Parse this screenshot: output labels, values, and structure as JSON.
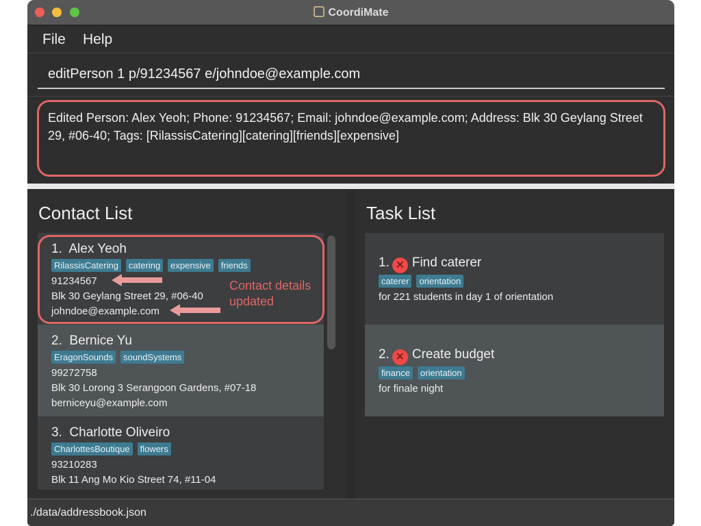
{
  "window": {
    "title": "CoordiMate"
  },
  "menu": [
    "File",
    "Help"
  ],
  "command": {
    "value": "editPerson 1 p/91234567 e/johndoe@example.com"
  },
  "result": {
    "text": "Edited Person: Alex Yeoh; Phone: 91234567; Email: johndoe@example.com; Address: Blk 30 Geylang Street 29, #06-40; Tags: [RilassisCatering][catering][friends][expensive]"
  },
  "contacts": {
    "title": "Contact List",
    "items": [
      {
        "index": "1.",
        "name": "Alex Yeoh",
        "tags": [
          "RilassisCatering",
          "catering",
          "expensive",
          "friends"
        ],
        "phone": "91234567",
        "address": "Blk 30 Geylang Street 29, #06-40",
        "email": "johndoe@example.com"
      },
      {
        "index": "2.",
        "name": "Bernice Yu",
        "tags": [
          "EragonSounds",
          "soundSystems"
        ],
        "phone": "99272758",
        "address": "Blk 30 Lorong 3 Serangoon Gardens, #07-18",
        "email": "berniceyu@example.com"
      },
      {
        "index": "3.",
        "name": "Charlotte Oliveiro",
        "tags": [
          "CharlottesBoutique",
          "flowers"
        ],
        "phone": "93210283",
        "address": "Blk 11 Ang Mo Kio Street 74, #11-04",
        "email": ""
      }
    ]
  },
  "tasks": {
    "title": "Task List",
    "items": [
      {
        "index": "1.",
        "name": "Find caterer",
        "status_icon": "x-circle-icon",
        "tags": [
          "caterer",
          "orientation"
        ],
        "note": "for 221 students in day 1 of orientation"
      },
      {
        "index": "2.",
        "name": "Create budget",
        "status_icon": "x-circle-icon",
        "tags": [
          "finance",
          "orientation"
        ],
        "note": "for finale night"
      }
    ]
  },
  "annotation": {
    "text1": "Contact details",
    "text2": "updated"
  },
  "status": {
    "path": "./data/addressbook.json"
  },
  "colors": {
    "tag": "#3e7b91",
    "highlight": "#e06666",
    "not_done": "#f04848"
  }
}
